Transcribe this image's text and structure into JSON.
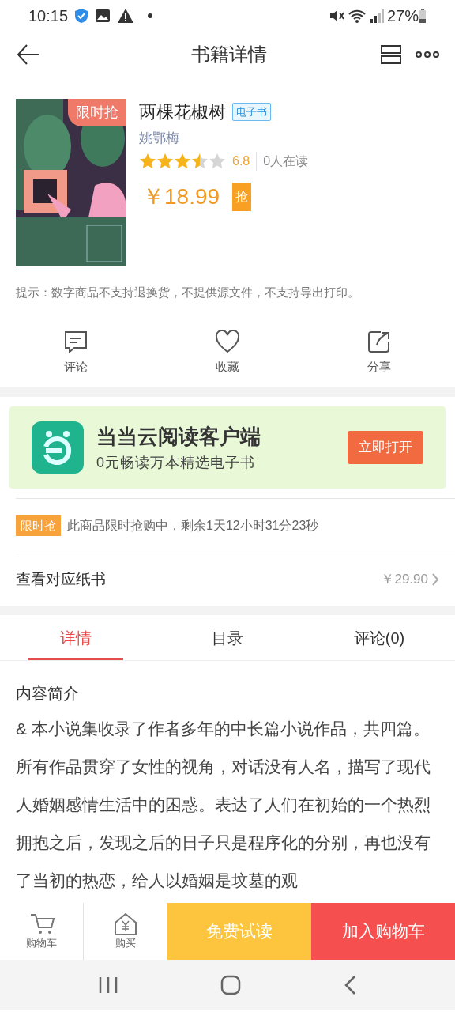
{
  "status_bar": {
    "time": "10:15",
    "battery": "27%"
  },
  "header": {
    "title": "书籍详情"
  },
  "book": {
    "badge": "限时抢",
    "title": "两棵花椒树",
    "tag": "电子书",
    "author": "姚鄂梅",
    "stars": 3.5,
    "score": "6.8",
    "readers": "0人在读",
    "price": "￥18.99",
    "price_tag": "抢"
  },
  "notice": "提示：数字商品不支持退换货，不提供源文件，不支持导出打印。",
  "actions": [
    {
      "kind": "comment",
      "label": "评论"
    },
    {
      "kind": "favorite",
      "label": "收藏"
    },
    {
      "kind": "share",
      "label": "分享"
    }
  ],
  "banner": {
    "title": "当当云阅读客户端",
    "subtitle": "0元畅读万本精选电子书",
    "button": "立即打开"
  },
  "flash_sale": {
    "tag": "限时抢",
    "text": "此商品限时抢购中，剩余1天12小时31分23秒"
  },
  "paper_book": {
    "label": "查看对应纸书",
    "price": "￥29.90"
  },
  "tabs": [
    {
      "label": "详情",
      "selected": true
    },
    {
      "label": "目录",
      "selected": false
    },
    {
      "label": "评论(0)",
      "selected": false
    }
  ],
  "intro": {
    "heading": "内容简介",
    "text": "& 本小说集收录了作者多年的中长篇小说作品，共四篇。所有作品贯穿了女性的视角，对话没有人名，描写了现代人婚姻感情生活中的困惑。表达了人们在初始的一个热烈拥抱之后，发现之后的日子只是程序化的分别，再也没有了当初的热恋，给人以婚姻是坟墓的观"
  },
  "bottom_bar": [
    {
      "kind": "cart",
      "label": "购物车"
    },
    {
      "kind": "buy",
      "label": "购买"
    },
    {
      "kind": "trial",
      "label": "免费试读"
    },
    {
      "kind": "add",
      "label": "加入购物车"
    }
  ]
}
